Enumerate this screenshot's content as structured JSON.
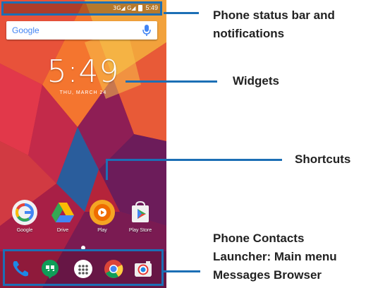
{
  "phone": {
    "status_time": "5:49",
    "status_signal": "3G◢ G◢",
    "search_brand": "Google",
    "clock_time": "5:49",
    "clock_date": "THU, MARCH 24",
    "apps": [
      {
        "label": "Google",
        "icon": "google-icon"
      },
      {
        "label": "Drive",
        "icon": "drive-icon"
      },
      {
        "label": "Play",
        "icon": "play-music-icon"
      },
      {
        "label": "Play Store",
        "icon": "play-store-icon"
      }
    ],
    "dock": [
      {
        "icon": "phone-icon"
      },
      {
        "icon": "hangouts-messages-icon"
      },
      {
        "icon": "app-launcher-icon"
      },
      {
        "icon": "chrome-browser-icon"
      },
      {
        "icon": "camera-icon"
      }
    ]
  },
  "callouts": {
    "status": "Phone status bar and notifications",
    "widgets": "Widgets",
    "shortcuts": "Shortcuts",
    "dock_line1": "Phone Contacts",
    "dock_line2": "Launcher: Main menu",
    "dock_line3": "Messages Browser"
  },
  "colors": {
    "callout_blue": "#1c6fb5",
    "google_blue": "#4285F4"
  }
}
